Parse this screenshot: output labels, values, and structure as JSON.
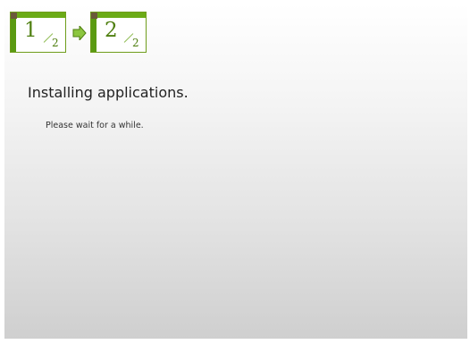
{
  "steps": {
    "current": {
      "number": "1",
      "total": "2"
    },
    "next": {
      "number": "2",
      "total": "2"
    },
    "accent_color": "#6bab16",
    "arrow_icon": "right-arrow-icon"
  },
  "main": {
    "title": "Installing applications.",
    "message": "Please wait for a while."
  }
}
